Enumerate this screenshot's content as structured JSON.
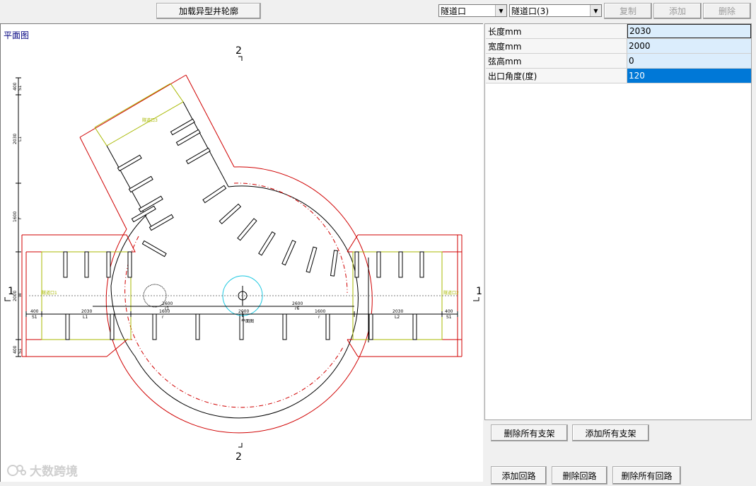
{
  "toolbar": {
    "load_button": "加载异型井轮廓",
    "combo1": "隧道口",
    "combo2": "隧道口(3)",
    "copy": "复制",
    "add": "添加",
    "delete": "删除"
  },
  "canvas": {
    "title": "平面图",
    "section_top": "2",
    "section_bottom": "2",
    "section_left": "1",
    "section_right": "1",
    "left_dims": [
      "400",
      "S1",
      "2030",
      "L1",
      "1600",
      "r",
      "2000",
      "W",
      "400",
      "S1"
    ],
    "bottom_dims": {
      "d400_left": "400",
      "s1_left": "S1",
      "d2030_left": "2030",
      "l1": "L1",
      "d1600_left": "1600",
      "r_left": "r",
      "d2600_left": "2600",
      "r1": "r1",
      "d2600_right": "2600",
      "r6": "r6",
      "d1600_right": "1600",
      "r_right": "r",
      "d2030_right": "2030",
      "l2": "L2",
      "d400_right": "400",
      "s1_right": "S1",
      "center_mark": "2000",
      "plan_label": "平面图"
    },
    "tunnel_left_label": "隧道口1",
    "tunnel_right_label": "隧道口2",
    "tunnel_top_label": "隧道口3"
  },
  "properties": [
    {
      "key": "长度mm",
      "value": "2030",
      "state": "focused"
    },
    {
      "key": "宽度mm",
      "value": "2000",
      "state": ""
    },
    {
      "key": "弦高mm",
      "value": "0",
      "state": ""
    },
    {
      "key": "出口角度(度)",
      "value": "120",
      "state": "selected"
    }
  ],
  "bottom_buttons": {
    "delete_all_supports": "删除所有支架",
    "add_all_supports": "添加所有支架",
    "add_loop": "添加回路",
    "delete_loop": "删除回路",
    "delete_all_loops": "删除所有回路"
  },
  "watermark": "大数跨境",
  "colors": {
    "outline": "#d00000",
    "inner": "#000000",
    "tunnel_inner": "#a8b800",
    "center_circle": "#19c7e0",
    "canvas_title": "#000080"
  }
}
